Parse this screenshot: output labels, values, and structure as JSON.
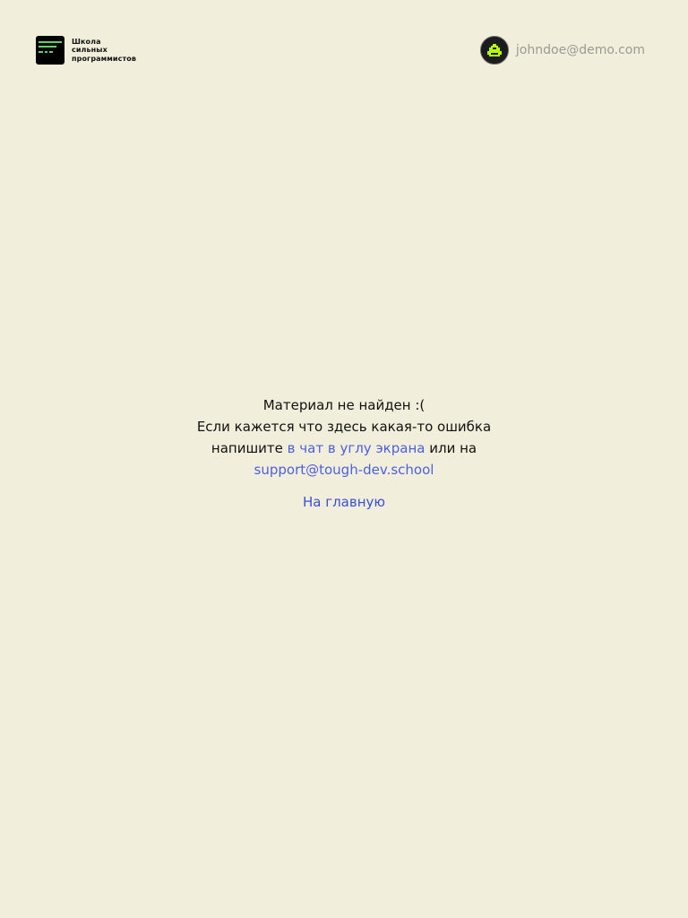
{
  "header": {
    "logo": {
      "line1": "Школа",
      "line2": "сильных",
      "line3": "программистов"
    },
    "user": {
      "email": "johndoe@demo.com",
      "avatar_icon": "pixel-invader-icon"
    }
  },
  "message": {
    "title": "Материал не найден :(",
    "text_before": "Если кажется что здесь какая-то ошибка напишите",
    "chat_link": "в чат в углу экрана",
    "text_middle": "или на",
    "email_link": "support@tough-dev.school",
    "home_button": "На главную"
  },
  "colors": {
    "background": "#f1efdc",
    "link": "#4c5fe0",
    "logo_accent": "#5fd35f",
    "avatar_accent": "#b6ff00"
  }
}
